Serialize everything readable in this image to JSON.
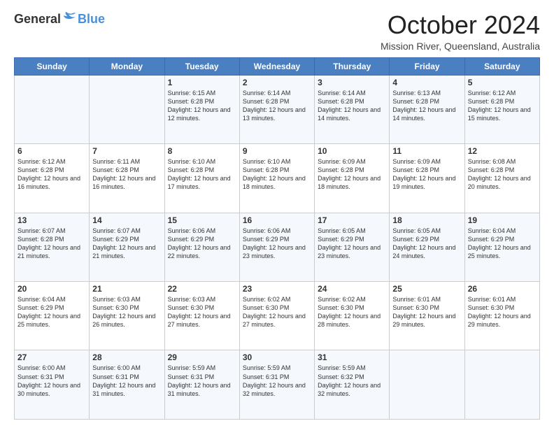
{
  "header": {
    "logo_general": "General",
    "logo_blue": "Blue",
    "month_title": "October 2024",
    "location": "Mission River, Queensland, Australia"
  },
  "days_of_week": [
    "Sunday",
    "Monday",
    "Tuesday",
    "Wednesday",
    "Thursday",
    "Friday",
    "Saturday"
  ],
  "weeks": [
    [
      {
        "day": "",
        "info": ""
      },
      {
        "day": "",
        "info": ""
      },
      {
        "day": "1",
        "info": "Sunrise: 6:15 AM\nSunset: 6:28 PM\nDaylight: 12 hours and 12 minutes."
      },
      {
        "day": "2",
        "info": "Sunrise: 6:14 AM\nSunset: 6:28 PM\nDaylight: 12 hours and 13 minutes."
      },
      {
        "day": "3",
        "info": "Sunrise: 6:14 AM\nSunset: 6:28 PM\nDaylight: 12 hours and 14 minutes."
      },
      {
        "day": "4",
        "info": "Sunrise: 6:13 AM\nSunset: 6:28 PM\nDaylight: 12 hours and 14 minutes."
      },
      {
        "day": "5",
        "info": "Sunrise: 6:12 AM\nSunset: 6:28 PM\nDaylight: 12 hours and 15 minutes."
      }
    ],
    [
      {
        "day": "6",
        "info": "Sunrise: 6:12 AM\nSunset: 6:28 PM\nDaylight: 12 hours and 16 minutes."
      },
      {
        "day": "7",
        "info": "Sunrise: 6:11 AM\nSunset: 6:28 PM\nDaylight: 12 hours and 16 minutes."
      },
      {
        "day": "8",
        "info": "Sunrise: 6:10 AM\nSunset: 6:28 PM\nDaylight: 12 hours and 17 minutes."
      },
      {
        "day": "9",
        "info": "Sunrise: 6:10 AM\nSunset: 6:28 PM\nDaylight: 12 hours and 18 minutes."
      },
      {
        "day": "10",
        "info": "Sunrise: 6:09 AM\nSunset: 6:28 PM\nDaylight: 12 hours and 18 minutes."
      },
      {
        "day": "11",
        "info": "Sunrise: 6:09 AM\nSunset: 6:28 PM\nDaylight: 12 hours and 19 minutes."
      },
      {
        "day": "12",
        "info": "Sunrise: 6:08 AM\nSunset: 6:28 PM\nDaylight: 12 hours and 20 minutes."
      }
    ],
    [
      {
        "day": "13",
        "info": "Sunrise: 6:07 AM\nSunset: 6:28 PM\nDaylight: 12 hours and 21 minutes."
      },
      {
        "day": "14",
        "info": "Sunrise: 6:07 AM\nSunset: 6:29 PM\nDaylight: 12 hours and 21 minutes."
      },
      {
        "day": "15",
        "info": "Sunrise: 6:06 AM\nSunset: 6:29 PM\nDaylight: 12 hours and 22 minutes."
      },
      {
        "day": "16",
        "info": "Sunrise: 6:06 AM\nSunset: 6:29 PM\nDaylight: 12 hours and 23 minutes."
      },
      {
        "day": "17",
        "info": "Sunrise: 6:05 AM\nSunset: 6:29 PM\nDaylight: 12 hours and 23 minutes."
      },
      {
        "day": "18",
        "info": "Sunrise: 6:05 AM\nSunset: 6:29 PM\nDaylight: 12 hours and 24 minutes."
      },
      {
        "day": "19",
        "info": "Sunrise: 6:04 AM\nSunset: 6:29 PM\nDaylight: 12 hours and 25 minutes."
      }
    ],
    [
      {
        "day": "20",
        "info": "Sunrise: 6:04 AM\nSunset: 6:29 PM\nDaylight: 12 hours and 25 minutes."
      },
      {
        "day": "21",
        "info": "Sunrise: 6:03 AM\nSunset: 6:30 PM\nDaylight: 12 hours and 26 minutes."
      },
      {
        "day": "22",
        "info": "Sunrise: 6:03 AM\nSunset: 6:30 PM\nDaylight: 12 hours and 27 minutes."
      },
      {
        "day": "23",
        "info": "Sunrise: 6:02 AM\nSunset: 6:30 PM\nDaylight: 12 hours and 27 minutes."
      },
      {
        "day": "24",
        "info": "Sunrise: 6:02 AM\nSunset: 6:30 PM\nDaylight: 12 hours and 28 minutes."
      },
      {
        "day": "25",
        "info": "Sunrise: 6:01 AM\nSunset: 6:30 PM\nDaylight: 12 hours and 29 minutes."
      },
      {
        "day": "26",
        "info": "Sunrise: 6:01 AM\nSunset: 6:30 PM\nDaylight: 12 hours and 29 minutes."
      }
    ],
    [
      {
        "day": "27",
        "info": "Sunrise: 6:00 AM\nSunset: 6:31 PM\nDaylight: 12 hours and 30 minutes."
      },
      {
        "day": "28",
        "info": "Sunrise: 6:00 AM\nSunset: 6:31 PM\nDaylight: 12 hours and 31 minutes."
      },
      {
        "day": "29",
        "info": "Sunrise: 5:59 AM\nSunset: 6:31 PM\nDaylight: 12 hours and 31 minutes."
      },
      {
        "day": "30",
        "info": "Sunrise: 5:59 AM\nSunset: 6:31 PM\nDaylight: 12 hours and 32 minutes."
      },
      {
        "day": "31",
        "info": "Sunrise: 5:59 AM\nSunset: 6:32 PM\nDaylight: 12 hours and 32 minutes."
      },
      {
        "day": "",
        "info": ""
      },
      {
        "day": "",
        "info": ""
      }
    ]
  ]
}
